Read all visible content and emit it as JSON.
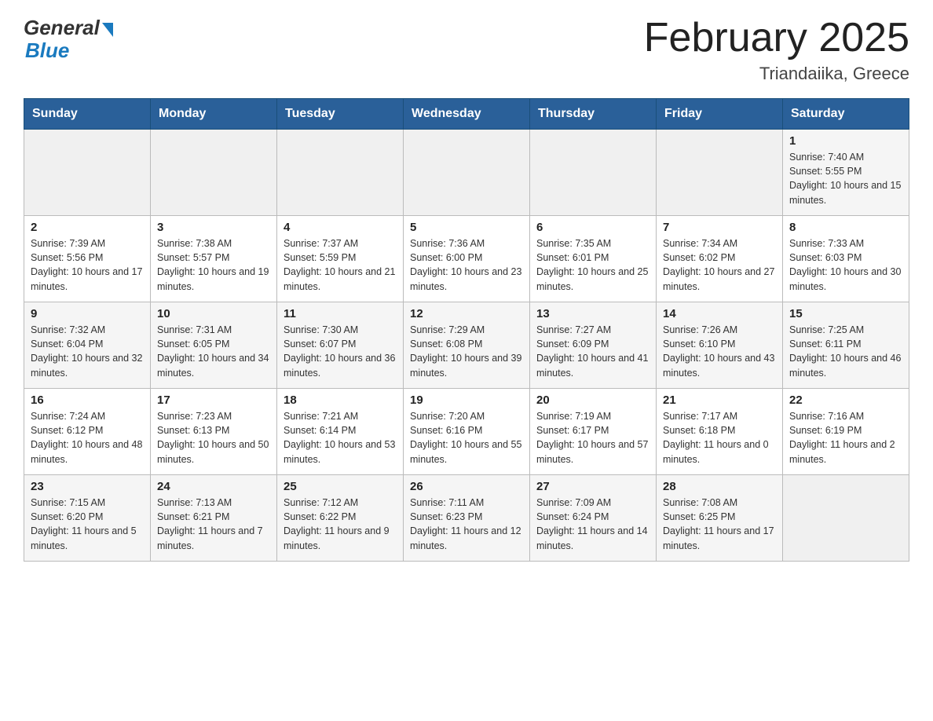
{
  "header": {
    "logo_general": "General",
    "logo_blue": "Blue",
    "month_title": "February 2025",
    "location": "Triandaiika, Greece"
  },
  "weekdays": [
    "Sunday",
    "Monday",
    "Tuesday",
    "Wednesday",
    "Thursday",
    "Friday",
    "Saturday"
  ],
  "weeks": [
    [
      {
        "day": "",
        "info": ""
      },
      {
        "day": "",
        "info": ""
      },
      {
        "day": "",
        "info": ""
      },
      {
        "day": "",
        "info": ""
      },
      {
        "day": "",
        "info": ""
      },
      {
        "day": "",
        "info": ""
      },
      {
        "day": "1",
        "info": "Sunrise: 7:40 AM\nSunset: 5:55 PM\nDaylight: 10 hours and 15 minutes."
      }
    ],
    [
      {
        "day": "2",
        "info": "Sunrise: 7:39 AM\nSunset: 5:56 PM\nDaylight: 10 hours and 17 minutes."
      },
      {
        "day": "3",
        "info": "Sunrise: 7:38 AM\nSunset: 5:57 PM\nDaylight: 10 hours and 19 minutes."
      },
      {
        "day": "4",
        "info": "Sunrise: 7:37 AM\nSunset: 5:59 PM\nDaylight: 10 hours and 21 minutes."
      },
      {
        "day": "5",
        "info": "Sunrise: 7:36 AM\nSunset: 6:00 PM\nDaylight: 10 hours and 23 minutes."
      },
      {
        "day": "6",
        "info": "Sunrise: 7:35 AM\nSunset: 6:01 PM\nDaylight: 10 hours and 25 minutes."
      },
      {
        "day": "7",
        "info": "Sunrise: 7:34 AM\nSunset: 6:02 PM\nDaylight: 10 hours and 27 minutes."
      },
      {
        "day": "8",
        "info": "Sunrise: 7:33 AM\nSunset: 6:03 PM\nDaylight: 10 hours and 30 minutes."
      }
    ],
    [
      {
        "day": "9",
        "info": "Sunrise: 7:32 AM\nSunset: 6:04 PM\nDaylight: 10 hours and 32 minutes."
      },
      {
        "day": "10",
        "info": "Sunrise: 7:31 AM\nSunset: 6:05 PM\nDaylight: 10 hours and 34 minutes."
      },
      {
        "day": "11",
        "info": "Sunrise: 7:30 AM\nSunset: 6:07 PM\nDaylight: 10 hours and 36 minutes."
      },
      {
        "day": "12",
        "info": "Sunrise: 7:29 AM\nSunset: 6:08 PM\nDaylight: 10 hours and 39 minutes."
      },
      {
        "day": "13",
        "info": "Sunrise: 7:27 AM\nSunset: 6:09 PM\nDaylight: 10 hours and 41 minutes."
      },
      {
        "day": "14",
        "info": "Sunrise: 7:26 AM\nSunset: 6:10 PM\nDaylight: 10 hours and 43 minutes."
      },
      {
        "day": "15",
        "info": "Sunrise: 7:25 AM\nSunset: 6:11 PM\nDaylight: 10 hours and 46 minutes."
      }
    ],
    [
      {
        "day": "16",
        "info": "Sunrise: 7:24 AM\nSunset: 6:12 PM\nDaylight: 10 hours and 48 minutes."
      },
      {
        "day": "17",
        "info": "Sunrise: 7:23 AM\nSunset: 6:13 PM\nDaylight: 10 hours and 50 minutes."
      },
      {
        "day": "18",
        "info": "Sunrise: 7:21 AM\nSunset: 6:14 PM\nDaylight: 10 hours and 53 minutes."
      },
      {
        "day": "19",
        "info": "Sunrise: 7:20 AM\nSunset: 6:16 PM\nDaylight: 10 hours and 55 minutes."
      },
      {
        "day": "20",
        "info": "Sunrise: 7:19 AM\nSunset: 6:17 PM\nDaylight: 10 hours and 57 minutes."
      },
      {
        "day": "21",
        "info": "Sunrise: 7:17 AM\nSunset: 6:18 PM\nDaylight: 11 hours and 0 minutes."
      },
      {
        "day": "22",
        "info": "Sunrise: 7:16 AM\nSunset: 6:19 PM\nDaylight: 11 hours and 2 minutes."
      }
    ],
    [
      {
        "day": "23",
        "info": "Sunrise: 7:15 AM\nSunset: 6:20 PM\nDaylight: 11 hours and 5 minutes."
      },
      {
        "day": "24",
        "info": "Sunrise: 7:13 AM\nSunset: 6:21 PM\nDaylight: 11 hours and 7 minutes."
      },
      {
        "day": "25",
        "info": "Sunrise: 7:12 AM\nSunset: 6:22 PM\nDaylight: 11 hours and 9 minutes."
      },
      {
        "day": "26",
        "info": "Sunrise: 7:11 AM\nSunset: 6:23 PM\nDaylight: 11 hours and 12 minutes."
      },
      {
        "day": "27",
        "info": "Sunrise: 7:09 AM\nSunset: 6:24 PM\nDaylight: 11 hours and 14 minutes."
      },
      {
        "day": "28",
        "info": "Sunrise: 7:08 AM\nSunset: 6:25 PM\nDaylight: 11 hours and 17 minutes."
      },
      {
        "day": "",
        "info": ""
      }
    ]
  ]
}
